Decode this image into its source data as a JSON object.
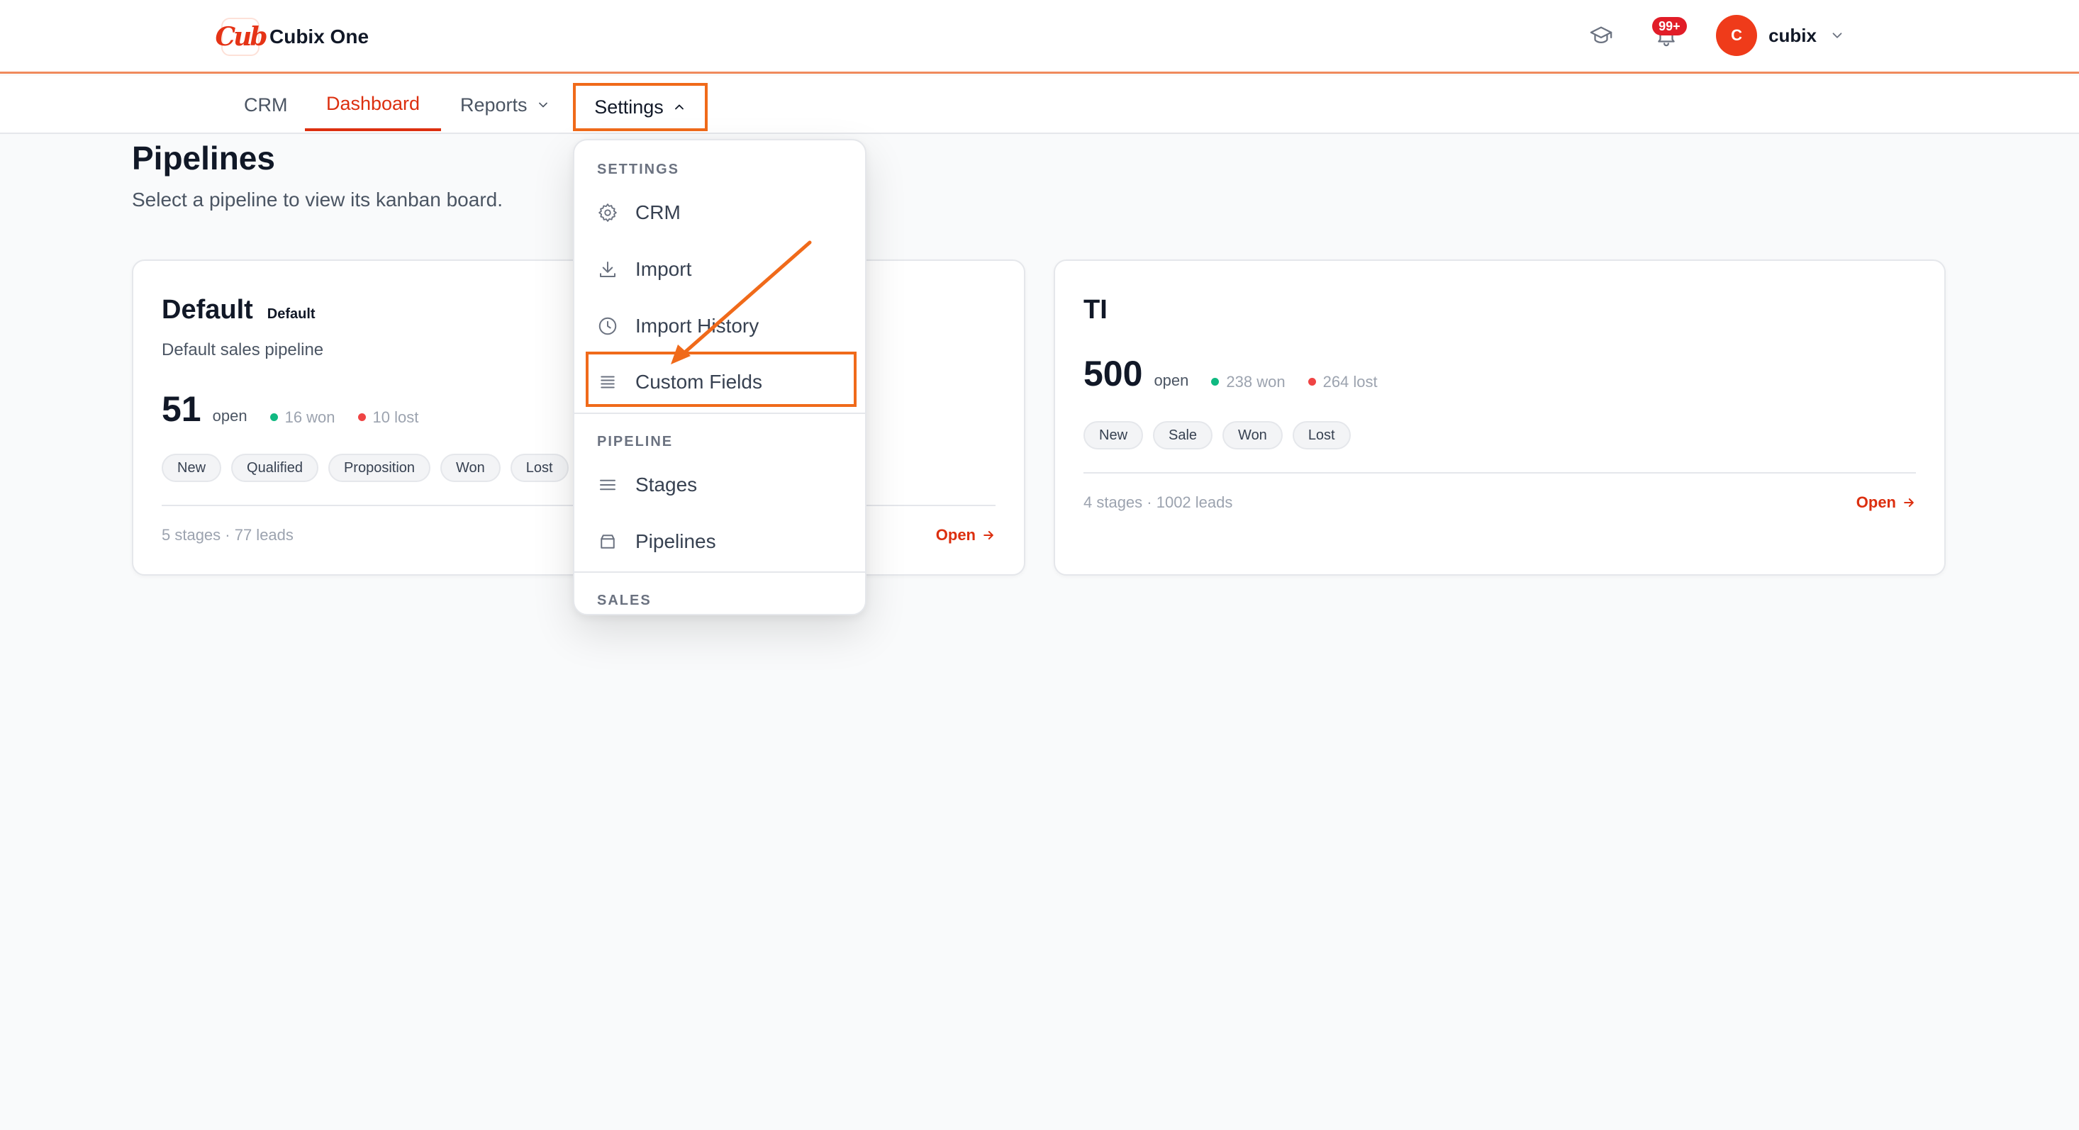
{
  "app": {
    "name": "Cubix One",
    "logo_text": "Cub"
  },
  "header": {
    "notification_count": "99+",
    "user": {
      "initial": "C",
      "name": "cubix"
    }
  },
  "nav": {
    "items": [
      {
        "label": "CRM"
      },
      {
        "label": "Dashboard",
        "active": true
      },
      {
        "label": "Reports"
      },
      {
        "label": "Settings",
        "expanded": true
      }
    ]
  },
  "page": {
    "title": "Pipelines",
    "subtitle": "Select a pipeline to view its kanban board."
  },
  "pipelines": [
    {
      "name": "Default",
      "tag": "Default",
      "description": "Default sales pipeline",
      "open": "51",
      "open_label": "open",
      "won": "16 won",
      "lost": "10 lost",
      "stages": [
        "New",
        "Qualified",
        "Proposition",
        "Won",
        "Lost"
      ],
      "meta": "5 stages · 77 leads",
      "open_link": "Open"
    },
    {
      "name": "TI",
      "open": "500",
      "open_label": "open",
      "won": "238 won",
      "lost": "264 lost",
      "stages": [
        "New",
        "Sale",
        "Won",
        "Lost"
      ],
      "meta": "4 stages · 1002 leads",
      "open_link": "Open"
    }
  ],
  "dropdown": {
    "sections": [
      {
        "title": "SETTINGS",
        "items": [
          {
            "label": "CRM",
            "icon": "gear-icon"
          },
          {
            "label": "Import",
            "icon": "download-icon"
          },
          {
            "label": "Import History",
            "icon": "clock-icon"
          },
          {
            "label": "Custom Fields",
            "icon": "list-icon",
            "highlighted": true
          }
        ]
      },
      {
        "title": "PIPELINE",
        "items": [
          {
            "label": "Stages",
            "icon": "menu-icon"
          },
          {
            "label": "Pipelines",
            "icon": "folder-icon"
          }
        ]
      },
      {
        "title": "SALES",
        "items": []
      }
    ]
  },
  "colors": {
    "accent": "#dc2f0f",
    "highlight": "#f06a1a",
    "won": "#10b981",
    "lost": "#ef4444"
  }
}
